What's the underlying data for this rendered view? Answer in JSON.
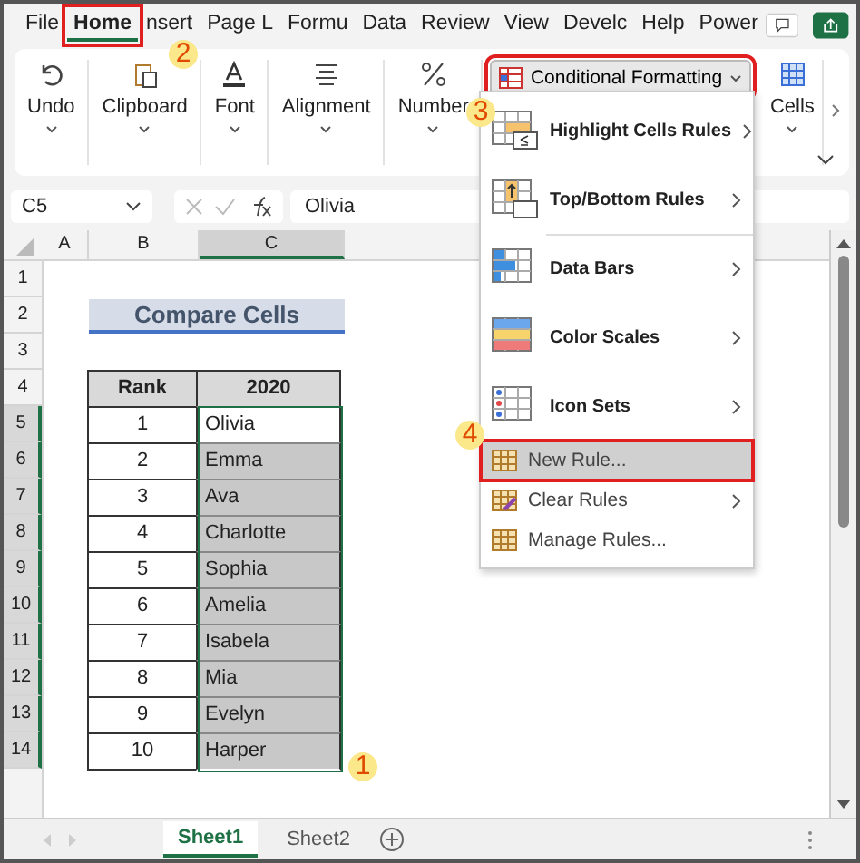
{
  "ribbon_tabs": [
    {
      "label": "File",
      "selected": false,
      "marked": false
    },
    {
      "label": "Home",
      "selected": true,
      "marked": true
    },
    {
      "label": "nsert",
      "selected": false,
      "marked": false
    },
    {
      "label": "Page L",
      "selected": false,
      "marked": false
    },
    {
      "label": "Formu",
      "selected": false,
      "marked": false
    },
    {
      "label": "Data",
      "selected": false,
      "marked": false
    },
    {
      "label": "Review",
      "selected": false,
      "marked": false
    },
    {
      "label": "View",
      "selected": false,
      "marked": false
    },
    {
      "label": "Develc",
      "selected": false,
      "marked": false
    },
    {
      "label": "Help",
      "selected": false,
      "marked": false
    },
    {
      "label": "Power",
      "selected": false,
      "marked": false
    }
  ],
  "ribbon_groups": [
    {
      "label": "Undo"
    },
    {
      "label": "Clipboard"
    },
    {
      "label": "Font"
    },
    {
      "label": "Alignment"
    },
    {
      "label": "Number"
    }
  ],
  "conditional_formatting": {
    "label": "Conditional Formatting",
    "marked": true
  },
  "cells_group": {
    "label": "Cells"
  },
  "name_box": "C5",
  "formula": "Olivia",
  "column_headers": [
    {
      "label": "A",
      "selected": false
    },
    {
      "label": "B",
      "selected": false
    },
    {
      "label": "C",
      "selected": true
    }
  ],
  "sheet_title": "Compare Cells",
  "table": {
    "columns": [
      "Rank",
      "2020"
    ],
    "rows": [
      {
        "rank": "1",
        "name": "Olivia",
        "active": true
      },
      {
        "rank": "2",
        "name": "Emma",
        "active": false
      },
      {
        "rank": "3",
        "name": "Ava",
        "active": false
      },
      {
        "rank": "4",
        "name": "Charlotte",
        "active": false
      },
      {
        "rank": "5",
        "name": "Sophia",
        "active": false
      },
      {
        "rank": "6",
        "name": "Amelia",
        "active": false
      },
      {
        "rank": "7",
        "name": "Isabela",
        "active": false
      },
      {
        "rank": "8",
        "name": "Mia",
        "active": false
      },
      {
        "rank": "9",
        "name": "Evelyn",
        "active": false
      },
      {
        "rank": "10",
        "name": "Harper",
        "active": false
      }
    ]
  },
  "row_numbers": [
    "1",
    "2",
    "3",
    "4",
    "5",
    "6",
    "7",
    "8",
    "9",
    "10",
    "11",
    "12",
    "13",
    "14"
  ],
  "menu": [
    {
      "kind": "large",
      "label": "Highlight Cells Rules",
      "submenu": true,
      "marked": false
    },
    {
      "kind": "large",
      "label": "Top/Bottom Rules",
      "submenu": true,
      "marked": false
    },
    {
      "kind": "large",
      "label": "Data Bars",
      "submenu": true,
      "marked": false
    },
    {
      "kind": "large",
      "label": "Color Scales",
      "submenu": true,
      "marked": false
    },
    {
      "kind": "large",
      "label": "Icon Sets",
      "submenu": true,
      "marked": false
    },
    {
      "kind": "small",
      "label": "New Rule...",
      "submenu": false,
      "marked": true
    },
    {
      "kind": "small",
      "label": "Clear Rules",
      "submenu": true,
      "marked": false
    },
    {
      "kind": "small",
      "label": "Manage Rules...",
      "submenu": false,
      "marked": false
    }
  ],
  "sheet_tabs": [
    {
      "label": "Sheet1",
      "selected": true
    },
    {
      "label": "Sheet2",
      "selected": false
    }
  ],
  "callouts": [
    "1",
    "2",
    "3",
    "4"
  ]
}
